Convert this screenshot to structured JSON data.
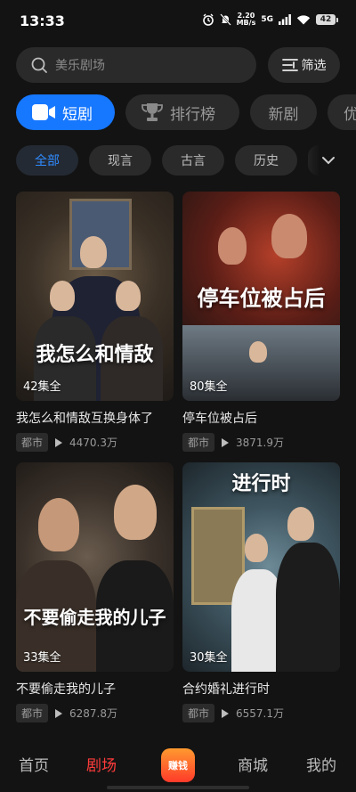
{
  "status_bar": {
    "time": "13:33",
    "net_speed_value": "2.20",
    "net_speed_unit": "MB/s",
    "network": "5G",
    "battery": "42"
  },
  "search": {
    "placeholder": "美乐剧场"
  },
  "filter": {
    "label": "筛选"
  },
  "tabs": [
    {
      "label": "短剧",
      "active": true,
      "icon": "video-camera-icon"
    },
    {
      "label": "排行榜",
      "active": false,
      "icon": "trophy-icon"
    },
    {
      "label": "新剧",
      "active": false
    },
    {
      "label": "优",
      "active": false
    }
  ],
  "chips": [
    {
      "label": "全部",
      "active": true
    },
    {
      "label": "现言",
      "active": false
    },
    {
      "label": "古言",
      "active": false
    },
    {
      "label": "历史",
      "active": false
    }
  ],
  "dramas": [
    {
      "title": "我怎么和情敌互换身体了",
      "poster_text": "我怎么和情敌",
      "episodes": "42集全",
      "genre": "都市",
      "plays": "4470.3万"
    },
    {
      "title": "停车位被占后",
      "poster_text": "停车位被占后",
      "episodes": "80集全",
      "genre": "都市",
      "plays": "3871.9万"
    },
    {
      "title": "不要偷走我的儿子",
      "poster_text": "不要偷走我的儿子",
      "episodes": "33集全",
      "genre": "都市",
      "plays": "6287.8万"
    },
    {
      "title": "合约婚礼进行时",
      "poster_text": "进行时",
      "episodes": "30集全",
      "genre": "都市",
      "plays": "6557.1万"
    }
  ],
  "bottom_nav": {
    "home": "首页",
    "theater": "剧场",
    "earn": "赚钱",
    "mall": "商城",
    "mine": "我的"
  },
  "colors": {
    "accent": "#1677ff",
    "nav_active": "#ff3b3b"
  }
}
